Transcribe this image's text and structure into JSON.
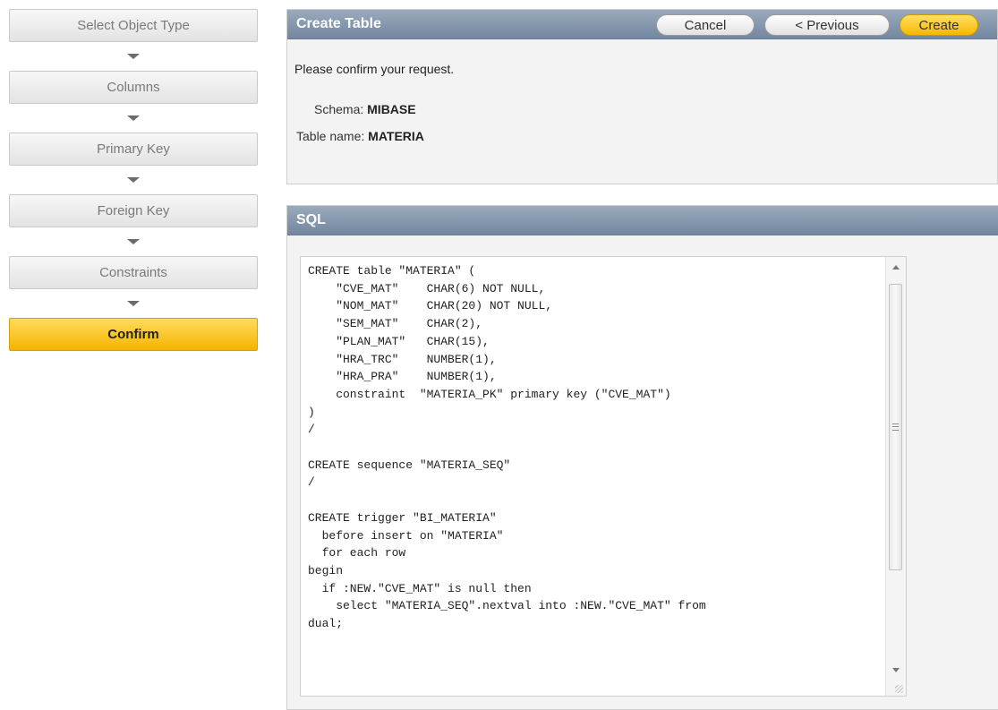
{
  "wizard": {
    "steps": [
      {
        "label": "Select Object Type"
      },
      {
        "label": "Columns"
      },
      {
        "label": "Primary Key"
      },
      {
        "label": "Foreign Key"
      },
      {
        "label": "Constraints"
      },
      {
        "label": "Confirm",
        "active": true
      }
    ]
  },
  "create_region": {
    "title": "Create Table",
    "buttons": {
      "cancel": "Cancel",
      "previous": "< Previous",
      "create": "Create"
    },
    "confirm_text": "Please confirm your request.",
    "schema_label": "Schema:",
    "schema_value": "MIBASE",
    "table_label": "Table name:",
    "table_value": "MATERIA"
  },
  "sql_region": {
    "title": "SQL",
    "sql_text": "CREATE table \"MATERIA\" (\n    \"CVE_MAT\"    CHAR(6) NOT NULL,\n    \"NOM_MAT\"    CHAR(20) NOT NULL,\n    \"SEM_MAT\"    CHAR(2),\n    \"PLAN_MAT\"   CHAR(15),\n    \"HRA_TRC\"    NUMBER(1),\n    \"HRA_PRA\"    NUMBER(1),\n    constraint  \"MATERIA_PK\" primary key (\"CVE_MAT\")\n)\n/\n\nCREATE sequence \"MATERIA_SEQ\"\n/\n\nCREATE trigger \"BI_MATERIA\"\n  before insert on \"MATERIA\"\n  for each row\nbegin\n  if :NEW.\"CVE_MAT\" is null then\n    select \"MATERIA_SEQ\".nextval into :NEW.\"CVE_MAT\" from\ndual;"
  },
  "icons": [
    "chevron-down-icon",
    "scroll-up-icon",
    "scroll-down-icon",
    "resize-grip-icon"
  ],
  "colors": {
    "accent": "#f5b400",
    "header": "#7a8ea6"
  }
}
